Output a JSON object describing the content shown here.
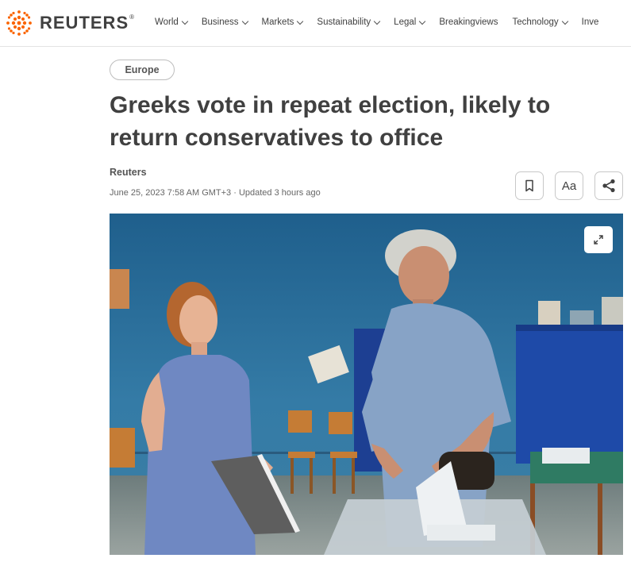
{
  "brand": {
    "name": "REUTERS",
    "registered": "®"
  },
  "nav": [
    {
      "label": "World",
      "dropdown": true
    },
    {
      "label": "Business",
      "dropdown": true
    },
    {
      "label": "Markets",
      "dropdown": true
    },
    {
      "label": "Sustainability",
      "dropdown": true
    },
    {
      "label": "Legal",
      "dropdown": true
    },
    {
      "label": "Breakingviews",
      "dropdown": false
    },
    {
      "label": "Technology",
      "dropdown": true
    },
    {
      "label": "Inve",
      "dropdown": false
    }
  ],
  "article": {
    "section_tag": "Europe",
    "headline_line1": "Greeks vote in repeat election, likely to",
    "headline_line2": "return conservatives to office",
    "byline": "Reuters",
    "dateline": "June 25, 2023 7:58 AM GMT+3 · Updated 3 hours ago"
  },
  "tools": {
    "text_size_label": "Aa"
  },
  "icons": [
    "reuters-logo-icon",
    "bookmark-icon",
    "share-icon",
    "expand-icon",
    "chevron-down-icon"
  ],
  "colors": {
    "text": "#404040",
    "reuters_orange": "#fa6400",
    "wall_blue": "#2e6c98"
  }
}
